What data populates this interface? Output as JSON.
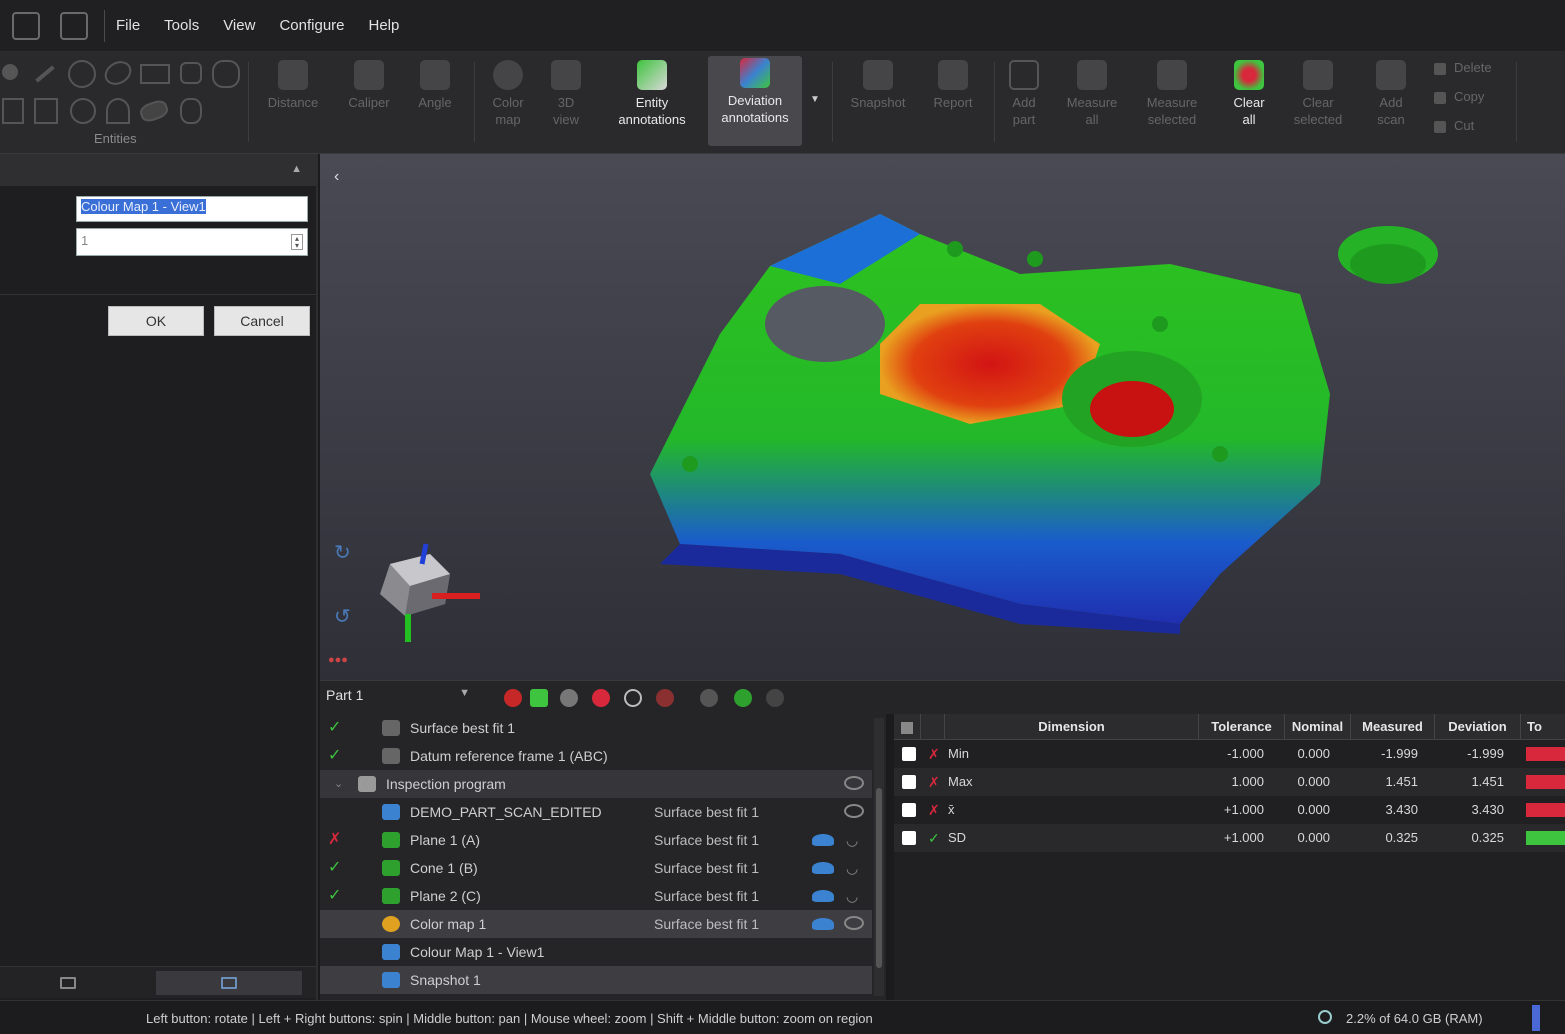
{
  "menu": {
    "items": [
      "File",
      "Tools",
      "View",
      "Configure",
      "Help"
    ]
  },
  "ribbon": {
    "entities_group": "Entities",
    "buttons": [
      {
        "label": "Distance",
        "enabled": false
      },
      {
        "label": "Caliper",
        "enabled": false
      },
      {
        "label": "Angle",
        "enabled": false
      },
      {
        "label": "Color\nmap",
        "enabled": false
      },
      {
        "label": "3D\nview",
        "enabled": false
      },
      {
        "label": "Entity\nannotations",
        "enabled": true
      },
      {
        "label": "Deviation\nannotations",
        "enabled": true,
        "selected": true
      },
      {
        "label": "Snapshot",
        "enabled": false
      },
      {
        "label": "Report",
        "enabled": false
      },
      {
        "label": "Add\npart",
        "enabled": false
      },
      {
        "label": "Measure\nall",
        "enabled": false
      },
      {
        "label": "Measure\nselected",
        "enabled": false
      },
      {
        "label": "Clear\nall",
        "enabled": true
      },
      {
        "label": "Clear\nselected",
        "enabled": false
      },
      {
        "label": "Add\nscan",
        "enabled": false
      }
    ],
    "small_commands": [
      "Delete",
      "Copy",
      "Cut"
    ]
  },
  "left_panel": {
    "name_value": "Colour Map 1 - View1",
    "number_value": "1",
    "ok_label": "OK",
    "cancel_label": "Cancel"
  },
  "part_toolbar": {
    "part_selected": "Part 1"
  },
  "tree": [
    {
      "status": "ok",
      "icon": "axis",
      "label": "Surface best fit 1",
      "ref": "",
      "indent": 1
    },
    {
      "status": "ok",
      "icon": "axis",
      "label": "Datum reference frame 1 (ABC)",
      "ref": "",
      "indent": 1
    },
    {
      "status": "",
      "icon": "folder",
      "label": "Inspection program",
      "ref": "",
      "indent": 0,
      "group": true
    },
    {
      "status": "",
      "icon": "scan",
      "label": "DEMO_PART_SCAN_EDITED",
      "ref": "Surface best fit 1",
      "indent": 1
    },
    {
      "status": "fail",
      "icon": "plane",
      "label": "Plane 1 (A)",
      "ref": "Surface best fit 1",
      "indent": 1
    },
    {
      "status": "ok",
      "icon": "cone",
      "label": "Cone 1 (B)",
      "ref": "Surface best fit 1",
      "indent": 1
    },
    {
      "status": "ok",
      "icon": "plane",
      "label": "Plane 2 (C)",
      "ref": "Surface best fit 1",
      "indent": 1
    },
    {
      "status": "",
      "icon": "colormap",
      "label": "Color map 1",
      "ref": "Surface best fit 1",
      "indent": 1,
      "highlight": true
    },
    {
      "status": "",
      "icon": "view",
      "label": "Colour Map 1 - View1",
      "ref": "",
      "indent": 1
    },
    {
      "status": "",
      "icon": "view",
      "label": "Snapshot 1",
      "ref": "",
      "indent": 1,
      "highlight": true
    }
  ],
  "results": {
    "columns": [
      "Dimension",
      "Tolerance",
      "Nominal",
      "Measured",
      "Deviation",
      "To"
    ],
    "rows": [
      {
        "status": "fail",
        "name": "Min",
        "tolerance": "-1.000",
        "nominal": "0.000",
        "measured": "-1.999",
        "deviation": "-1.999",
        "bar": "#d8283c"
      },
      {
        "status": "fail",
        "name": "Max",
        "tolerance": "1.000",
        "nominal": "0.000",
        "measured": "1.451",
        "deviation": "1.451",
        "bar": "#d8283c"
      },
      {
        "status": "fail",
        "name": "x̄",
        "tolerance": "+1.000",
        "nominal": "0.000",
        "measured": "3.430",
        "deviation": "3.430",
        "bar": "#d8283c"
      },
      {
        "status": "ok",
        "name": "SD",
        "tolerance": "+1.000",
        "nominal": "0.000",
        "measured": "0.325",
        "deviation": "0.325",
        "bar": "#3ec43e"
      }
    ]
  },
  "status": {
    "hints": "Left button: rotate | Left + Right buttons: spin | Middle button: pan | Mouse wheel: zoom | Shift + Middle button: zoom on region",
    "memory": "2.2% of 64.0 GB (RAM)"
  },
  "colors": {
    "ok": "#3ec43e",
    "fail": "#d8283c",
    "accent": "#4a68d8"
  }
}
